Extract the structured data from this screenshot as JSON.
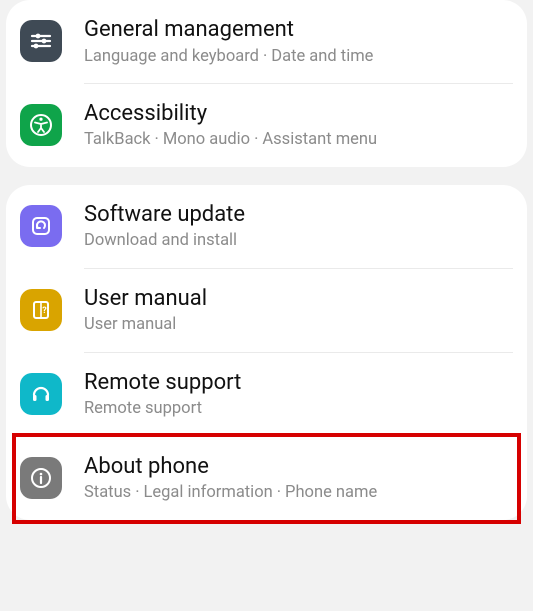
{
  "group1": {
    "general": {
      "title": "General management",
      "sub1": "Language and keyboard",
      "sub2": "Date and time"
    },
    "accessibility": {
      "title": "Accessibility",
      "sub1": "TalkBack",
      "sub2": "Mono audio",
      "sub3": "Assistant menu"
    }
  },
  "group2": {
    "update": {
      "title": "Software update",
      "sub": "Download and install"
    },
    "manual": {
      "title": "User manual",
      "sub": "User manual"
    },
    "remote": {
      "title": "Remote support",
      "sub": "Remote support"
    },
    "about": {
      "title": "About phone",
      "sub1": "Status",
      "sub2": "Legal information",
      "sub3": "Phone name"
    }
  },
  "sep": "·"
}
